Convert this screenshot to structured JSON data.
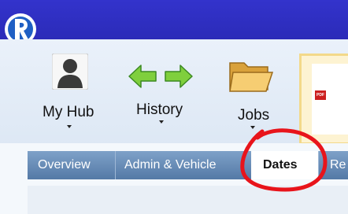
{
  "app": {
    "logo_icon": "app-logo-icon",
    "titlebar_color": "#3333cc"
  },
  "ribbon": {
    "buttons": [
      {
        "label": "My Hub",
        "icon": "person-silhouette-icon"
      },
      {
        "label": "History",
        "icon": "back-forward-arrows-icon"
      },
      {
        "label": "Jobs",
        "icon": "folder-icon"
      }
    ],
    "preview_badge": "PDF"
  },
  "tabs": [
    {
      "label": "Overview",
      "selected": false
    },
    {
      "label": "Admin & Vehicle",
      "selected": false
    },
    {
      "label": "Dates",
      "selected": true
    },
    {
      "label": "Re",
      "selected": false
    }
  ],
  "colors": {
    "tab_background": "#5479a6",
    "selected_tab": "#ffffff",
    "annotation": "#e8141b"
  }
}
